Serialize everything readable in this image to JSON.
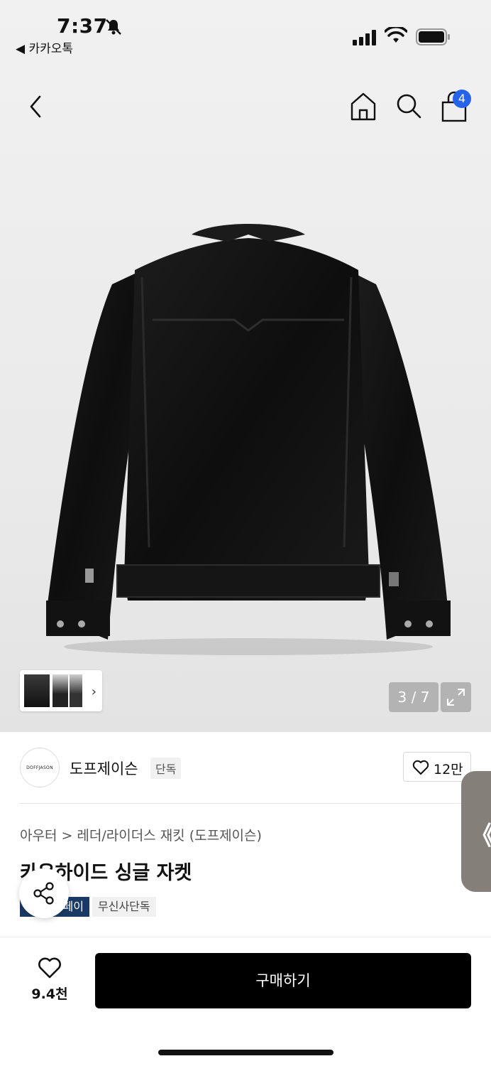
{
  "status_bar": {
    "time": "7:37",
    "back_app": "◀ 카카오톡"
  },
  "header": {
    "cart_count": "4"
  },
  "gallery": {
    "counter": "3 / 7",
    "thumbnail_arrow": "›"
  },
  "brand": {
    "logo_text": "DOFFJASON",
    "name": "도프제이슨",
    "tag": "단독",
    "likes": "12만"
  },
  "product": {
    "breadcrumb": [
      "아우터",
      "레더/라이더스 재킷 (도프제이슨)"
    ],
    "breadcrumb_separator": ">",
    "title": "카우하이드 싱글 자켓",
    "badges": [
      "페이",
      "무신사단독"
    ]
  },
  "side_tab": {
    "glyph": "《"
  },
  "bottom_bar": {
    "wish_count": "9.4천",
    "buy_label": "구매하기"
  },
  "colors": {
    "badge_blue": "#2563eb",
    "pay_badge": "#1b3a63",
    "buy_button": "#000000"
  },
  "icons": [
    "bell-slash-icon",
    "signal-icon",
    "wifi-icon",
    "battery-icon",
    "chevron-left-icon",
    "home-icon",
    "search-icon",
    "shopping-bag-icon",
    "expand-icon",
    "heart-icon",
    "share-icon"
  ]
}
